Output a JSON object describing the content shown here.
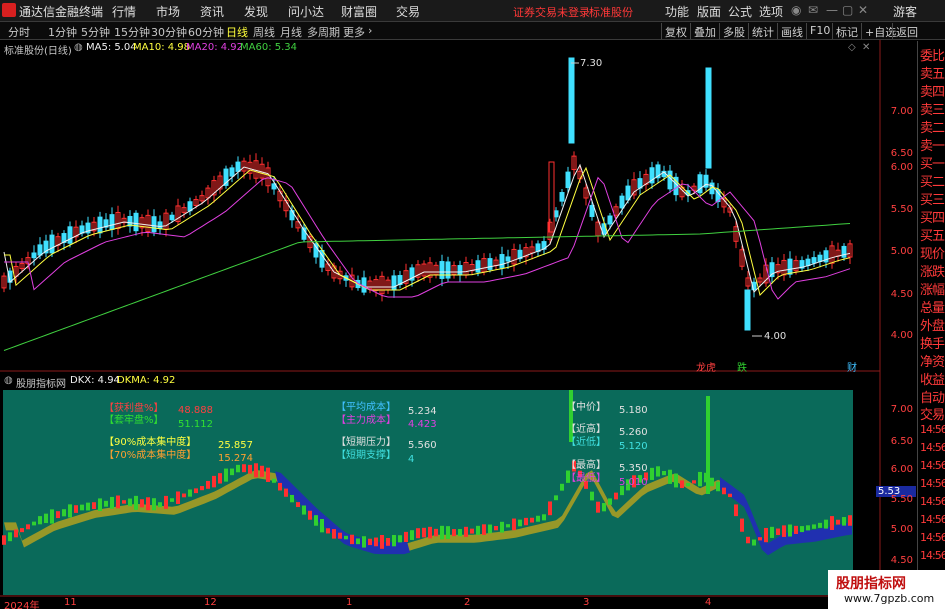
{
  "menubar": {
    "app_title": "通达信金融终端",
    "items": [
      "行情",
      "市场",
      "资讯",
      "发现",
      "问小达",
      "财富圈",
      "交易"
    ],
    "warning": "证券交易未登录",
    "warning2": "标准股份",
    "right_items": [
      "功能",
      "版面",
      "公式",
      "选项"
    ],
    "user": "游客"
  },
  "toolbar": {
    "periods": [
      "分时",
      "1分钟",
      "5分钟",
      "15分钟",
      "30分钟",
      "60分钟",
      "日线",
      "周线",
      "月线",
      "多周期",
      "更多"
    ],
    "active_period": "日线",
    "right_buttons": [
      "复权",
      "叠加",
      "多股",
      "统计",
      "画线",
      "F10",
      "标记",
      "+自选",
      "返回"
    ]
  },
  "main_chart": {
    "stock_name": "标准股份(日线)",
    "ma5": "MA5: 5.04",
    "ma10": "MA10: 4.98",
    "ma20": "MA20: 4.92",
    "ma60": "MA60: 5.34",
    "high_label": "7.30",
    "low_label": "4.00",
    "y_ticks": [
      "7.00",
      "6.50",
      "6.00",
      "5.50",
      "5.00",
      "4.50",
      "4.00"
    ],
    "markers": [
      "龙虎",
      "跌",
      "财"
    ]
  },
  "sub_chart": {
    "name": "股朋指标网",
    "dkx": "DKX: 4.94",
    "dkma": "DKMA: 4.92",
    "labels": {
      "profit_pct": "【获利盘%】",
      "profit_val": "48.888",
      "trapped_pct": "【套牢盘%】",
      "trapped_val": "51.112",
      "conc90": "【90%成本集中度】",
      "conc90_val": "25.857",
      "conc70": "【70%成本集中度】",
      "conc70_val": "15.274",
      "avg_cost": "【平均成本】",
      "avg_cost_val": "5.234",
      "main_cost": "【主力成本】",
      "main_cost_val": "4.423",
      "short_pressure": "【短期压力】",
      "short_pressure_val": "5.560",
      "short_support": "【短期支撑】",
      "short_support_val": "4",
      "mid": "【中价】",
      "mid_val": "5.180",
      "near_high": "【近高】",
      "near_high_val": "5.260",
      "near_low": "【近低】",
      "near_low_val": "5.120",
      "highest": "【最高】",
      "highest_val": "5.350",
      "lowest": "【最低】",
      "lowest_val": "5.010"
    },
    "y_ticks": [
      "7.00",
      "6.50",
      "6.00",
      "5.50",
      "5.00",
      "4.50"
    ],
    "current_price": "5.53"
  },
  "x_axis": [
    "2024年",
    "11",
    "12",
    "1",
    "2",
    "3",
    "4"
  ],
  "right_panel": [
    "委比",
    "卖五",
    "卖四",
    "卖三",
    "卖二",
    "卖一",
    "买一",
    "买二",
    "买三",
    "买四",
    "买五",
    "现价",
    "涨跌",
    "涨幅",
    "总量",
    "外盘",
    "换手",
    "净资",
    "收益"
  ],
  "right_panel_bottom": [
    "自动",
    "交易",
    "14:56",
    "14:56",
    "14:56",
    "14:56",
    "14:56",
    "14:56",
    "14:56",
    "14:56",
    "14:56"
  ],
  "watermark": {
    "title": "股朋指标网",
    "url": "www.7gpzb.com"
  },
  "colors": {
    "up": "#ff3030",
    "down": "#40e0ff",
    "ma5": "#f0f0f0",
    "ma10": "#ffff40",
    "ma20": "#e040e0",
    "ma60": "#40d040",
    "sub_bg": "#0a6a5a"
  }
}
